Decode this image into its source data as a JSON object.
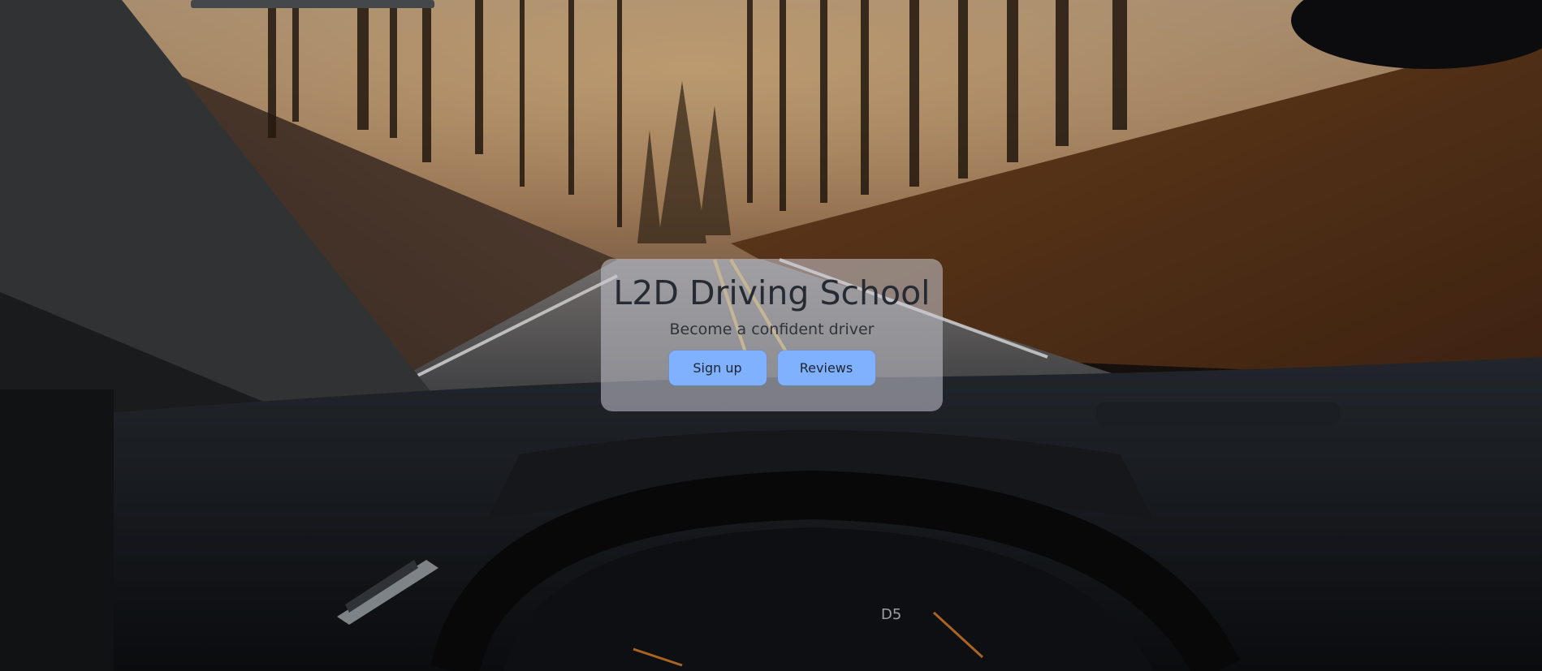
{
  "hero": {
    "title": "L2D Driving School",
    "subtitle": "Become a confident driver",
    "buttons": {
      "signup_label": "Sign up",
      "reviews_label": "Reviews"
    },
    "button_color": "#7fb1ff"
  },
  "cluster": {
    "gear": "D5"
  }
}
